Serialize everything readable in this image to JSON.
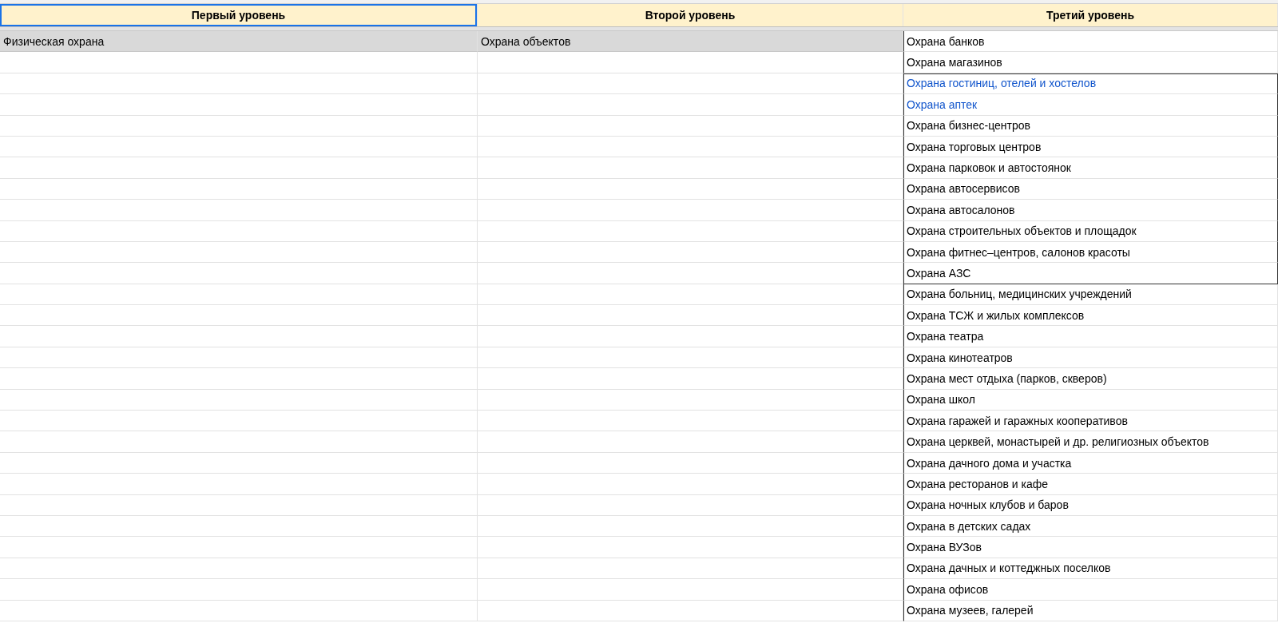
{
  "table": {
    "columns": [
      {
        "label": "Первый уровень",
        "selected": true
      },
      {
        "label": "Второй уровень",
        "selected": false
      },
      {
        "label": "Третий уровень",
        "selected": false
      }
    ],
    "rows": [
      {
        "first": "Физическая охрана",
        "second": "Охрана объектов",
        "third": "Охрана банков",
        "highlighted": true,
        "outlined": false
      },
      {
        "third": "Охрана магазинов",
        "highlighted": false,
        "outlined": false
      },
      {
        "third": "Охрана гостиниц, отелей и хостелов",
        "highlighted": false,
        "outlined": true,
        "color": "#1155cc"
      },
      {
        "third": "Охрана аптек",
        "highlighted": false,
        "outlined": true,
        "color": "#1155cc"
      },
      {
        "third": "Охрана бизнес-центров",
        "highlighted": false,
        "outlined": true
      },
      {
        "third": "Охрана торговых центров",
        "highlighted": false,
        "outlined": true
      },
      {
        "third": "Охрана парковок и автостоянок",
        "highlighted": false,
        "outlined": true
      },
      {
        "third": "Охрана автосервисов",
        "highlighted": false,
        "outlined": true
      },
      {
        "third": "Охрана автосалонов",
        "highlighted": false,
        "outlined": true
      },
      {
        "third": "Охрана строительных объектов и площадок",
        "highlighted": false,
        "outlined": true
      },
      {
        "third": "Охрана фитнес–центров, салонов красоты",
        "highlighted": false,
        "outlined": true
      },
      {
        "third": "Охрана АЗС",
        "highlighted": false,
        "outlined": true
      },
      {
        "third": "Охрана больниц, медицинских учреждений",
        "highlighted": false,
        "outlined": false
      },
      {
        "third": "Охрана ТСЖ и жилых комплексов",
        "highlighted": false,
        "outlined": false
      },
      {
        "third": "Охрана театра",
        "highlighted": false,
        "outlined": false
      },
      {
        "third": "Охрана кинотеатров",
        "highlighted": false,
        "outlined": false
      },
      {
        "third": "Охрана мест отдыха (парков, скверов)",
        "highlighted": false,
        "outlined": false
      },
      {
        "third": "Охрана школ",
        "highlighted": false,
        "outlined": false
      },
      {
        "third": "Охрана гаражей и гаражных кооперативов",
        "highlighted": false,
        "outlined": false
      },
      {
        "third": "Охрана церквей, монастырей и др. религиозных объектов",
        "highlighted": false,
        "outlined": false
      },
      {
        "third": "Охрана дачного дома и участка",
        "highlighted": false,
        "outlined": false
      },
      {
        "third": "Охрана ресторанов и кафе",
        "highlighted": false,
        "outlined": false
      },
      {
        "third": "Охрана ночных клубов и баров",
        "highlighted": false,
        "outlined": false
      },
      {
        "third": "Охрана в детских садах",
        "highlighted": false,
        "outlined": false
      },
      {
        "third": "Охрана ВУЗов",
        "highlighted": false,
        "outlined": false
      },
      {
        "third": "Охрана дачных и коттеджных поселков",
        "highlighted": false,
        "outlined": false
      },
      {
        "third": "Охрана офисов",
        "highlighted": false,
        "outlined": false
      },
      {
        "third": "Охрана музеев, галерей",
        "highlighted": false,
        "outlined": false
      }
    ]
  }
}
